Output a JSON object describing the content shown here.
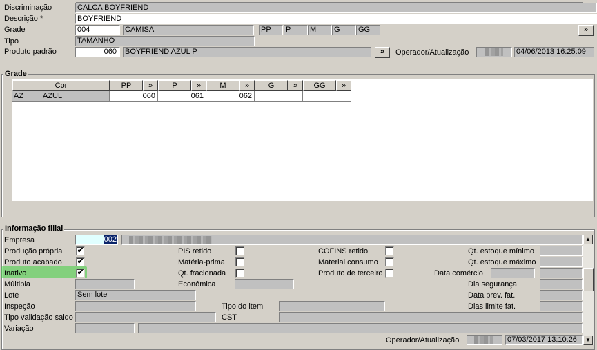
{
  "header": {
    "discriminacao": {
      "label": "Discriminação",
      "value": "CALCA BOYFRIEND"
    },
    "descricao": {
      "label": "Descrição *",
      "value": "BOYFRIEND"
    },
    "grade": {
      "label": "Grade",
      "code": "004",
      "name": "CAMISA",
      "sizes": [
        "PP",
        "P",
        "M",
        "G",
        "GG"
      ]
    },
    "tipo": {
      "label": "Tipo",
      "value": "TAMANHO"
    },
    "produto_padrao": {
      "label": "Produto padrão",
      "code": "060",
      "name": "BOYFRIEND AZUL P"
    },
    "operador": {
      "label": "Operador/Atualização",
      "datetime": "04/06/2013 16:25:09"
    },
    "arrow": "»"
  },
  "grade_section": {
    "title": "Grade",
    "columns": [
      "Cor",
      "PP",
      "P",
      "M",
      "G",
      "GG"
    ],
    "rows": [
      {
        "code": "AZ",
        "color": "AZUL",
        "pp": "060",
        "p": "061",
        "m": "062",
        "g": "",
        "gg": ""
      }
    ]
  },
  "info_filial": {
    "title": "Informação filial",
    "empresa": {
      "label": "Empresa",
      "code": "002"
    },
    "col1": {
      "producao_propria": {
        "label": "Produção própria",
        "checked": true
      },
      "produto_acabado": {
        "label": "Produto acabado",
        "checked": true
      },
      "inativo": {
        "label": "Inativo",
        "checked": true
      },
      "multipla": {
        "label": "Múltipla"
      },
      "lote": {
        "label": "Lote",
        "value": "Sem lote"
      },
      "inspecao": {
        "label": "Inspeção"
      },
      "tipo_validacao": {
        "label": "Tipo validação saldo"
      },
      "variacao": {
        "label": "Variação"
      }
    },
    "col2": {
      "pis_retido": {
        "label": "PIS retido"
      },
      "materia_prima": {
        "label": "Matéria-prima"
      },
      "qt_fracionada": {
        "label": "Qt. fracionada"
      },
      "economica": {
        "label": "Econômica"
      },
      "tipo_item": {
        "label": "Tipo do item"
      },
      "cst": {
        "label": "CST"
      }
    },
    "col3": {
      "cofins_retido": {
        "label": "COFINS retido"
      },
      "material_consumo": {
        "label": "Material consumo"
      },
      "produto_terceiro": {
        "label": "Produto de terceiro"
      },
      "data_comercio": {
        "label": "Data comércio"
      }
    },
    "col4": {
      "qt_estoque_minimo": {
        "label": "Qt. estoque mínimo"
      },
      "qt_estoque_maximo": {
        "label": "Qt. estoque máximo"
      },
      "dia_seguranca": {
        "label": "Dia segurança"
      },
      "data_prev_fat": {
        "label": "Data prev. fat."
      },
      "dias_limite_fat": {
        "label": "Dias limite fat."
      }
    },
    "operador": {
      "label": "Operador/Atualização",
      "datetime": "07/03/2017 13:10:26"
    },
    "check_mark": "✔",
    "scroll_up": "▲",
    "scroll_down": "▼"
  }
}
